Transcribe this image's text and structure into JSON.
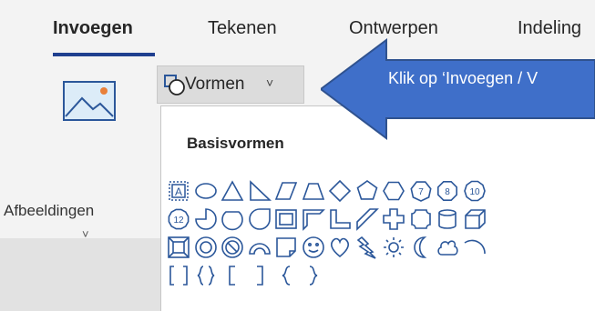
{
  "tabs": [
    {
      "label": "Invoegen",
      "active": true
    },
    {
      "label": "Tekenen",
      "active": false
    },
    {
      "label": "Ontwerpen",
      "active": false
    },
    {
      "label": "Indeling",
      "active": false
    }
  ],
  "picture_button": {
    "label": "Afbeeldingen",
    "icon": "picture-icon",
    "chevron": "˅"
  },
  "shapes_button": {
    "label": "Vormen",
    "icon": "shapes-icon",
    "chevron": "˅"
  },
  "shapes_gallery": {
    "title": "Basisvormen",
    "rows": [
      [
        "text-box",
        "oval",
        "triangle",
        "right-triangle",
        "parallelogram",
        "trapezoid",
        "diamond",
        "pentagon",
        "hexagon",
        "heptagon",
        "octagon",
        "decagon"
      ],
      [
        "dodecagon",
        "pie",
        "chord",
        "teardrop",
        "frame",
        "half-frame",
        "l-shape",
        "diagonal-stripe",
        "cross",
        "plaque",
        "can",
        "cube"
      ],
      [
        "bevel",
        "donut",
        "no-symbol",
        "block-arc",
        "folded-corner",
        "smiley-face",
        "heart",
        "lightning-bolt",
        "sun",
        "moon",
        "cloud",
        "arc"
      ],
      [
        "double-bracket",
        "double-brace",
        "left-bracket",
        "right-bracket",
        "left-brace",
        "right-brace"
      ]
    ],
    "number_labels": {
      "heptagon": "7",
      "octagon": "8",
      "decagon": "10",
      "dodecagon": "12"
    },
    "text_box_label": "A"
  },
  "callout": {
    "text": "Klik op ‘Invoegen / V",
    "color": "#3f6fc9",
    "border": "#2f528f"
  },
  "colors": {
    "accent": "#1f3f8f",
    "shape_stroke": "#2b579a",
    "ribbon": "#f3f3f3"
  }
}
